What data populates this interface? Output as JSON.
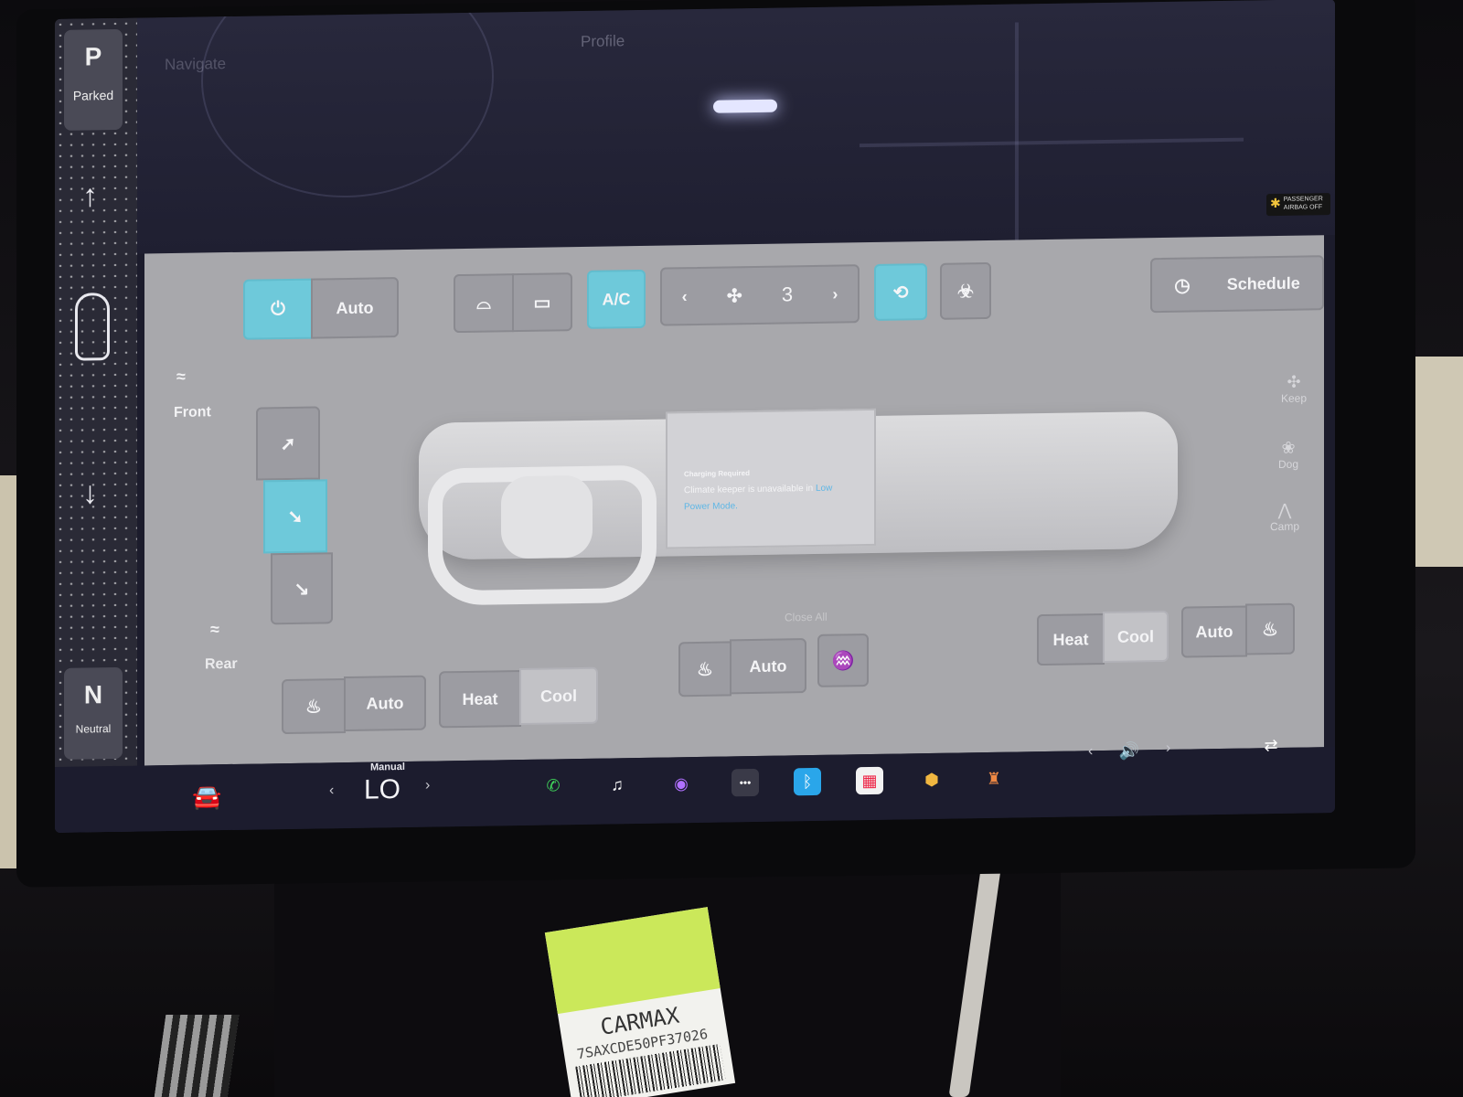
{
  "map": {
    "search_placeholder": "Navigate",
    "profile": "Profile",
    "status": ""
  },
  "status": {
    "airbag_line1": "PASSENGER",
    "airbag_line2": "AIRBAG OFF"
  },
  "gear": {
    "park_letter": "P",
    "park_label": "Parked",
    "neutral_letter": "N",
    "neutral_label": "Neutral"
  },
  "climate": {
    "auto_label": "Auto",
    "ac_label": "A/C",
    "fan_speed": "3",
    "schedule_label": "Schedule",
    "front_label": "Front",
    "rear_label": "Rear",
    "close_all": "Close All"
  },
  "message": {
    "title": "Charging Required",
    "body": "Climate keeper is unavailable in ",
    "link": "Low Power Mode."
  },
  "keeper": {
    "keep": "Keep",
    "dog": "Dog",
    "camp": "Camp"
  },
  "seats": {
    "driver": {
      "auto": "Auto",
      "heat": "Heat",
      "cool": "Cool"
    },
    "center": {
      "auto": "Auto"
    },
    "passenger": {
      "heat": "Heat",
      "cool": "Cool",
      "auto": "Auto"
    }
  },
  "bottom": {
    "temp_mode": "Manual",
    "temperature": "LO"
  },
  "sticker": {
    "brand": "CARMAX",
    "code": "7SAXCDE50PF37026"
  },
  "colors": {
    "active_accent": "#6ec9da",
    "panel_bg": "#a8a8ac",
    "bottom_bar": "#1c1c2e"
  }
}
